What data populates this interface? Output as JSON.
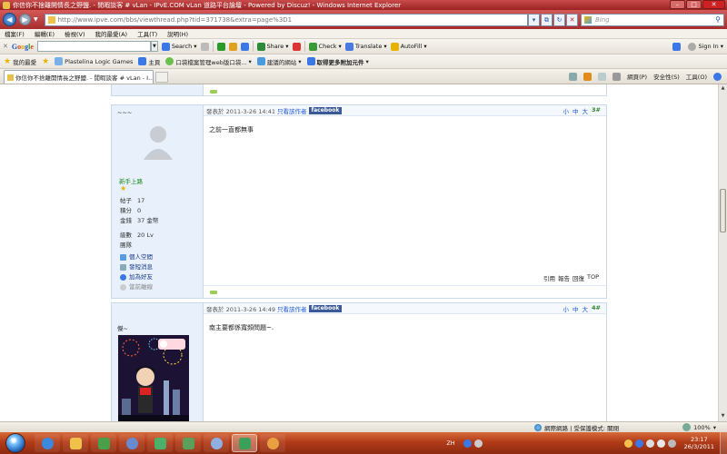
{
  "window": {
    "title": "你信你不捨離開情長之野鹽. - 閒暇談客 # vLan - IPvE.COM vLan 道路平台論壇 - Powered by Discuz! - Windows Internet Explorer",
    "minimize": "–",
    "maximize": "□",
    "close": "✕"
  },
  "address": {
    "url": "http://www.ipve.com/bbs/viewthread.php?tid=371738&extra=page%3D1",
    "search_placeholder": "Bing"
  },
  "menu": [
    "檔案(F)",
    "編輯(E)",
    "檢視(V)",
    "我的最愛(A)",
    "工具(T)",
    "說明(H)"
  ],
  "google_toolbar": {
    "logo": [
      "G",
      "o",
      "o",
      "g",
      "l",
      "e"
    ],
    "search": "Search",
    "share": "Share",
    "check": "Check",
    "translate": "Translate",
    "autofill": "AutoFill",
    "signin": "Sign In"
  },
  "favorites": {
    "label": "我的最愛",
    "items": [
      "Plastelina Logic Games",
      "主頁",
      "口袋檔案管理web版口袋...",
      "建議的網站",
      "取得更多附加元件"
    ]
  },
  "tab": {
    "title": "你信你不捨離開情長之野鹽. - 閒暇談客 # vLan - I..."
  },
  "commands": {
    "page": "網頁(P)",
    "safety": "安全性(S)",
    "tools": "工具(O)"
  },
  "posts": [
    {
      "username": "~~~",
      "rank": "新手上路",
      "stats": [
        {
          "k": "帖子",
          "v": "17"
        },
        {
          "k": "積分",
          "v": "0"
        },
        {
          "k": "金錢",
          "v": "37 金幣"
        }
      ],
      "stats2": [
        {
          "k": "級數",
          "v": "20 Lv"
        },
        {
          "k": "團隊",
          "v": ""
        }
      ],
      "actions": [
        "個人空間",
        "發短消息",
        "加為好友",
        "當前離線"
      ],
      "posted": "發表於 2011-3-26 14:41",
      "only_author": "只看該作者",
      "facebook": "facebook",
      "sizes": [
        "小",
        "中",
        "大"
      ],
      "floor": "3#",
      "body": "之前一直都無事",
      "footer": [
        "引用",
        "報告",
        "回復",
        "TOP"
      ]
    },
    {
      "username": "傑~",
      "posted": "發表於 2011-3-26 14:49",
      "only_author": "只看該作者",
      "facebook": "facebook",
      "sizes": [
        "小",
        "中",
        "大"
      ],
      "floor": "4#",
      "body": "南主要都係寬頻問題~."
    }
  ],
  "statusbar": {
    "zone": "網際網路 | 受保護模式: 關閉",
    "zoom": "100%"
  },
  "taskbar": {
    "lang": "ZH",
    "time": "23:17",
    "date": "26/3/2011"
  }
}
